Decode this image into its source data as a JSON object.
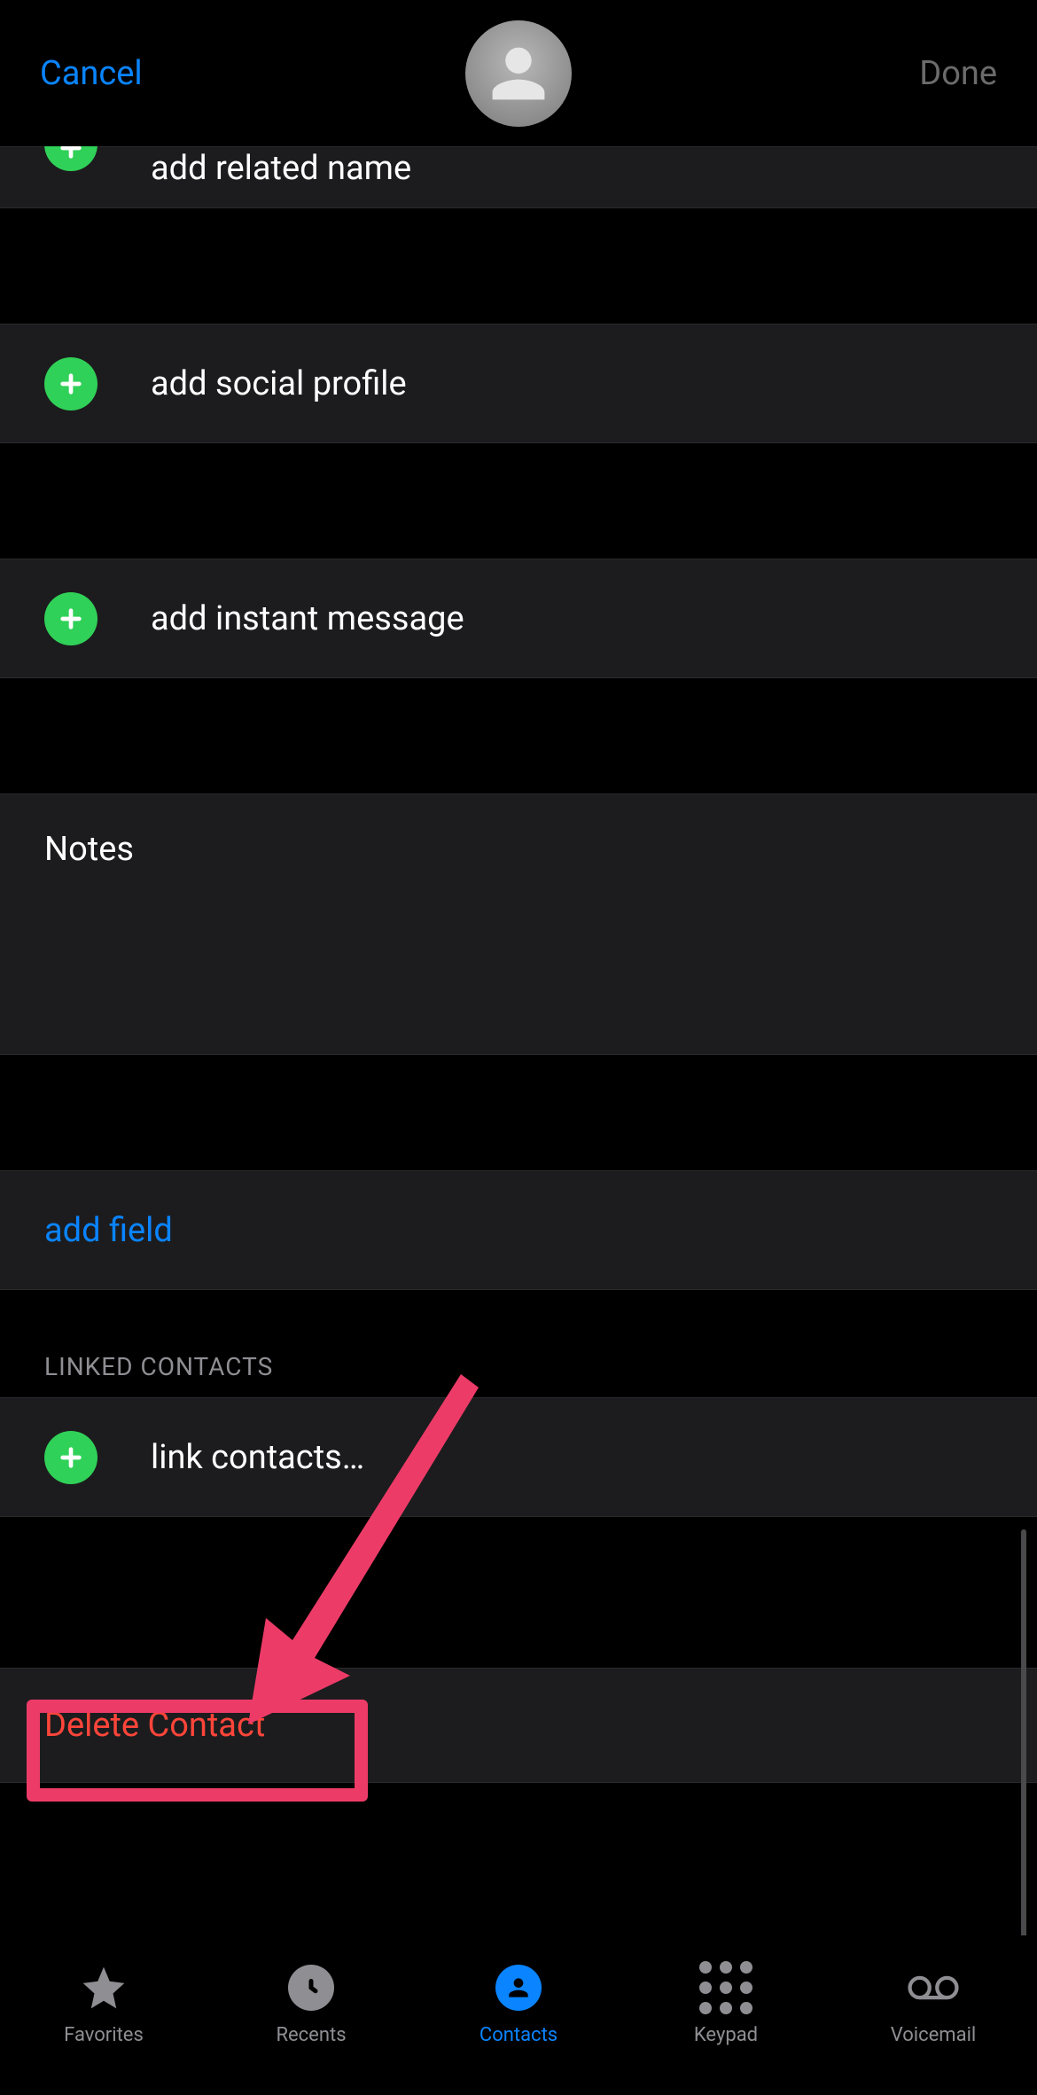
{
  "header": {
    "cancel": "Cancel",
    "done": "Done"
  },
  "rows": {
    "related_name": "add related name",
    "social_profile": "add social profile",
    "instant_message": "add instant message",
    "notes_label": "Notes",
    "add_field": "add field",
    "linked_header": "LINKED CONTACTS",
    "link_contacts": "link contacts…",
    "delete": "Delete Contact"
  },
  "tabs": {
    "favorites": "Favorites",
    "recents": "Recents",
    "contacts": "Contacts",
    "keypad": "Keypad",
    "voicemail": "Voicemail"
  },
  "colors": {
    "accent": "#0a84ff",
    "destructive": "#ff453a",
    "add_green": "#30d158",
    "annotation": "#ed3b68"
  }
}
